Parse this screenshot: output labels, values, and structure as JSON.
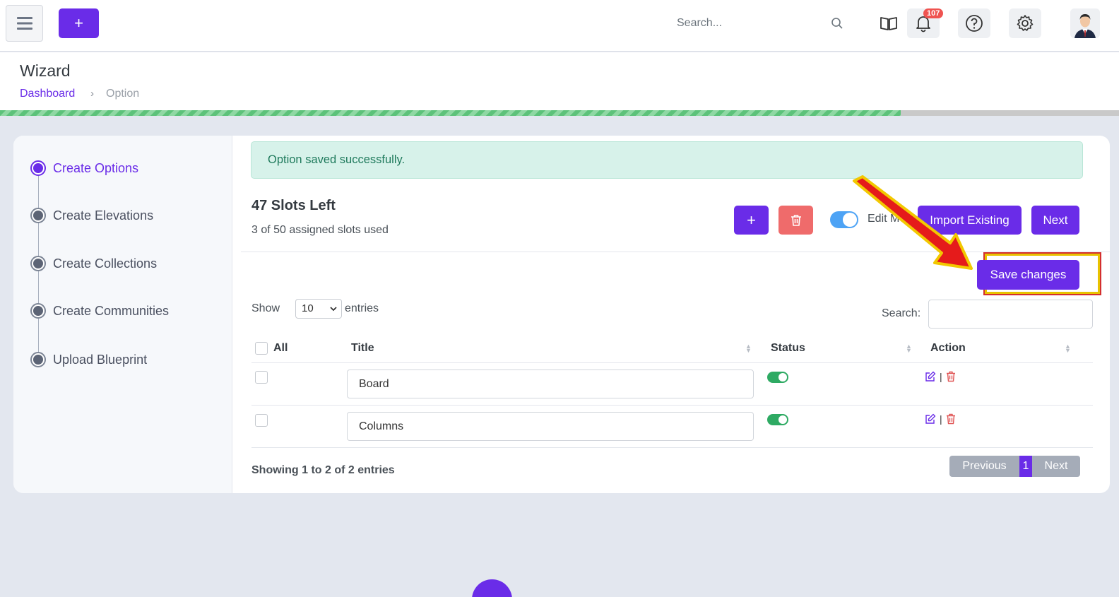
{
  "topbar": {
    "add_label": "+",
    "search_placeholder": "Search...",
    "notification_count": "107"
  },
  "header": {
    "title": "Wizard",
    "breadcrumb": [
      "Dashboard",
      "›",
      "Option"
    ]
  },
  "progress_percent": 80.5,
  "steps": [
    {
      "label": "Create Options",
      "active": true
    },
    {
      "label": "Create Elevations",
      "active": false
    },
    {
      "label": "Create Collections",
      "active": false
    },
    {
      "label": "Create Communities",
      "active": false
    },
    {
      "label": "Upload Blueprint",
      "active": false
    }
  ],
  "alert": "Option saved successfully.",
  "slots": {
    "title": "47 Slots Left",
    "subtitle": "3 of 50 assigned slots used"
  },
  "toolbar": {
    "add_label": "+",
    "edit_mode_label": "Edit Mode",
    "import_label": "Import Existing",
    "next_label": "Next",
    "save_label": "Save changes"
  },
  "table": {
    "show_label": "Show",
    "page_size": "10",
    "entries_label": "entries",
    "search_label": "Search:",
    "headers": {
      "all": "All",
      "title": "Title",
      "status": "Status",
      "action": "Action"
    },
    "rows": [
      {
        "title": "Board",
        "status": "on"
      },
      {
        "title": "Columns",
        "status": "on"
      }
    ],
    "action_sep": "|",
    "showing": "Showing 1 to 2 of 2 entries",
    "pager": {
      "prev": "Previous",
      "page": "1",
      "next": "Next"
    }
  },
  "colors": {
    "accent": "#6a2ce8",
    "danger": "#ef6b6b",
    "success": "#2eaa63"
  }
}
